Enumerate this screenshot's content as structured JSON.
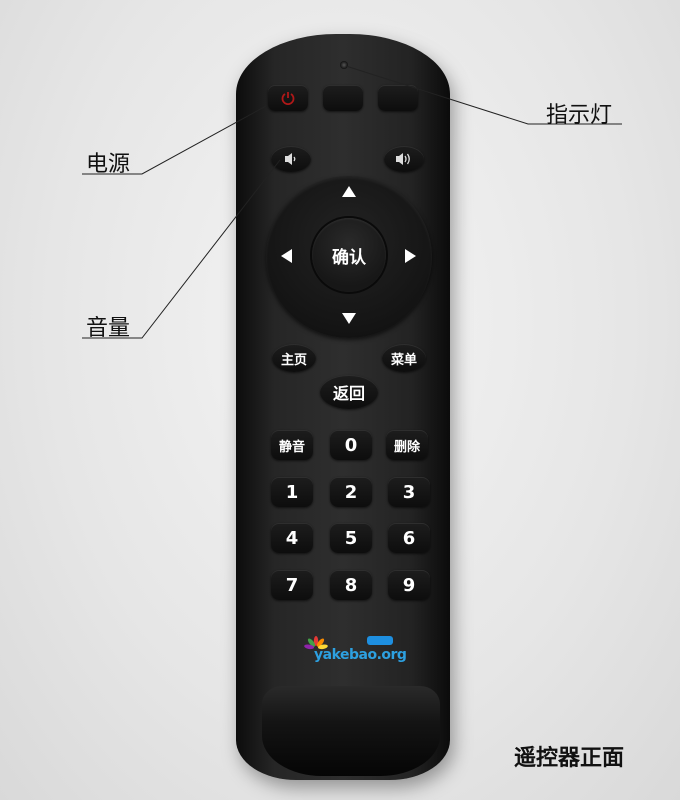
{
  "callouts": {
    "indicator": "指示灯",
    "power": "电源",
    "volume": "音量"
  },
  "caption": "遥控器正面",
  "remote": {
    "ok_label": "确认",
    "home_label": "主页",
    "menu_label": "菜单",
    "back_label": "返回",
    "mute_label": "静音",
    "delete_label": "删除",
    "digits": [
      "0",
      "1",
      "2",
      "3",
      "4",
      "5",
      "6",
      "7",
      "8",
      "9"
    ],
    "logo_text": "yakebao.org"
  },
  "colors": {
    "body": "#262626",
    "button": "#141414",
    "power_icon": "#b01818",
    "logo_blue": "#2da0e0"
  }
}
